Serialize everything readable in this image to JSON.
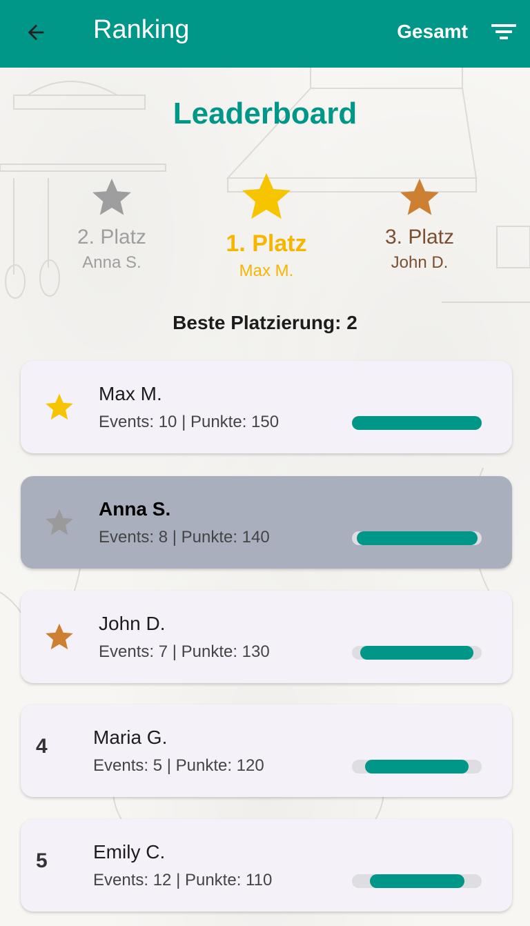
{
  "appbar": {
    "title": "Ranking",
    "scope": "Gesamt",
    "back_icon": "arrow-left-icon",
    "filter_icon": "filter-icon"
  },
  "colors": {
    "primary": "#009688",
    "gold": "#f7b500",
    "silver": "#9e9e9e",
    "bronze": "#c97a2f"
  },
  "headline": "Leaderboard",
  "podium": {
    "first": {
      "place": "1. Platz",
      "name": "Max M."
    },
    "second": {
      "place": "2. Platz",
      "name": "Anna S."
    },
    "third": {
      "place": "3. Platz",
      "name": "John D."
    }
  },
  "best_placement": "Beste Platzierung: 2",
  "ranking": [
    {
      "rank": "1",
      "name": "Max M.",
      "stats": "Events: 10 | Punkte: 150",
      "progress": 1.0,
      "badge": "gold-star-icon"
    },
    {
      "rank": "2",
      "name": "Anna S.",
      "stats": "Events: 8 | Punkte: 140",
      "progress": 0.93,
      "badge": "silver-star-icon",
      "current_user": true
    },
    {
      "rank": "3",
      "name": "John D.",
      "stats": "Events: 7 | Punkte: 130",
      "progress": 0.87,
      "badge": "bronze-star-icon"
    },
    {
      "rank": "4",
      "name": "Maria G.",
      "stats": "Events: 5 | Punkte: 120",
      "progress": 0.8
    },
    {
      "rank": "5",
      "name": "Emily C.",
      "stats": "Events: 12 | Punkte: 110",
      "progress": 0.73
    }
  ]
}
